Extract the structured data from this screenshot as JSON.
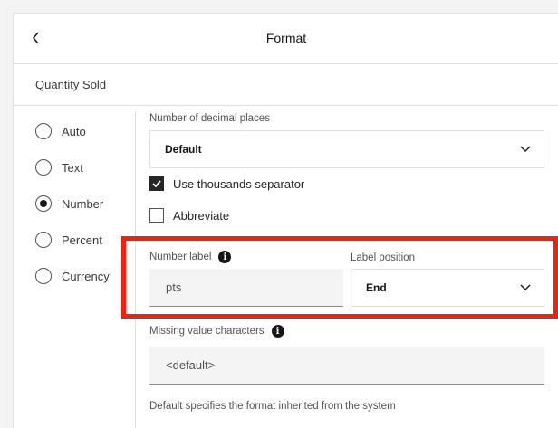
{
  "header": {
    "title": "Format"
  },
  "subheader": {
    "title": "Quantity Sold"
  },
  "format_types": [
    {
      "label": "Auto",
      "checked": false
    },
    {
      "label": "Text",
      "checked": false
    },
    {
      "label": "Number",
      "checked": true
    },
    {
      "label": "Percent",
      "checked": false
    },
    {
      "label": "Currency",
      "checked": false
    }
  ],
  "decimal_places": {
    "label": "Number of decimal places",
    "value": "Default"
  },
  "thousands_separator": {
    "label": "Use thousands separator",
    "checked": true
  },
  "abbreviate": {
    "label": "Abbreviate",
    "checked": false
  },
  "number_label": {
    "label": "Number label",
    "value": "pts"
  },
  "label_position": {
    "label": "Label position",
    "value": "End"
  },
  "missing_value": {
    "label": "Missing value characters",
    "placeholder": "<default>"
  },
  "helper_text": "Default specifies the format inherited from the system",
  "icons": {
    "back": "chevron-left-icon",
    "dropdown": "chevron-down-icon",
    "info": "information-icon"
  },
  "colors": {
    "highlight": "#f4200b",
    "panel": "#ffffff",
    "field": "#f4f4f4"
  }
}
